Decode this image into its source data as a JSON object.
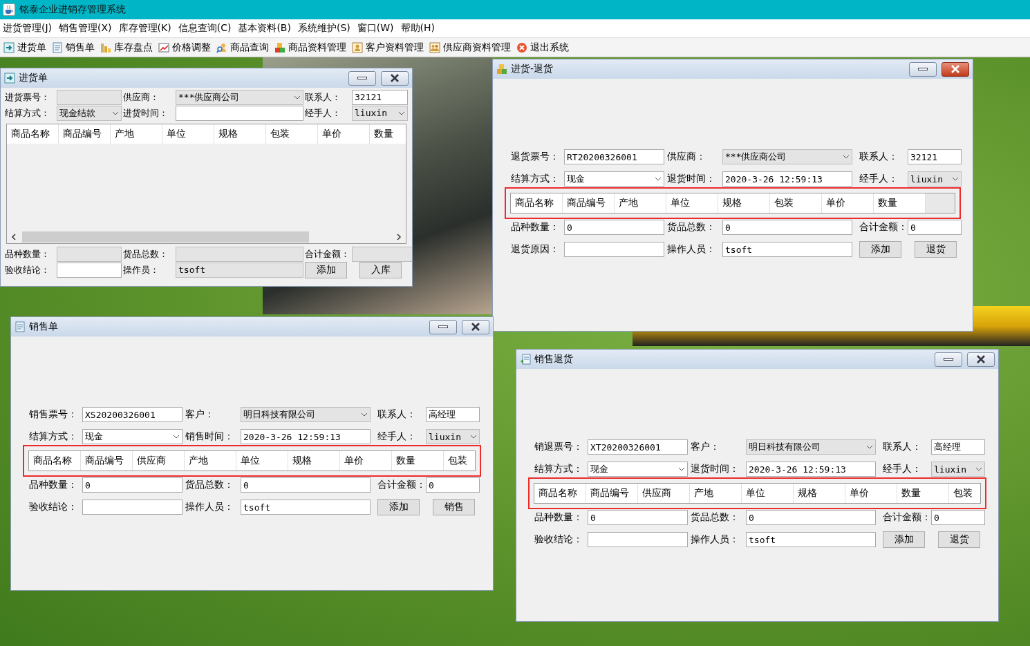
{
  "window": {
    "title": "铭泰企业进销存管理系统"
  },
  "menu": [
    "进货管理(J)",
    "销售管理(X)",
    "库存管理(K)",
    "信息查询(C)",
    "基本资料(B)",
    "系统维护(S)",
    "窗口(W)",
    "帮助(H)"
  ],
  "toolbar": [
    "进货单",
    "销售单",
    "库存盘点",
    "价格调整",
    "商品查询",
    "商品资料管理",
    "客户资料管理",
    "供应商资料管理",
    "退出系统"
  ],
  "windows": [
    {
      "kind": "compact",
      "title": "进货单",
      "active": false,
      "highlighted": false,
      "top_rows": [
        [
          {
            "label": "进货票号：",
            "kind": "text",
            "disabled": true
          },
          {
            "label": "供应商：",
            "value": "***供应商公司",
            "kind": "combo",
            "disabled": true
          },
          {
            "label": "联系人：",
            "value": "32121",
            "kind": "text",
            "disabled": false
          }
        ],
        [
          {
            "label": "结算方式：",
            "value": "现金结款",
            "kind": "combo",
            "disabled": true
          },
          {
            "label": "进货时间：",
            "kind": "text",
            "disabled": false
          },
          {
            "label": "经手人：",
            "value": "liuxin",
            "kind": "combo",
            "disabled": true
          }
        ]
      ],
      "columns": [
        "商品名称",
        "商品编号",
        "产地",
        "单位",
        "规格",
        "包装",
        "单价",
        "数量"
      ],
      "bottom_rows": [
        [
          {
            "label": "品种数量：",
            "kind": "text",
            "disabled": true
          },
          {
            "label": "货品总数：",
            "kind": "text",
            "disabled": true
          },
          {
            "label": "合计金额：",
            "kind": "text",
            "disabled": true
          }
        ],
        [
          {
            "label": "验收结论：",
            "kind": "text",
            "disabled": false
          },
          {
            "label": "操作员：",
            "value": "tsoft",
            "kind": "text",
            "disabled": true
          }
        ]
      ],
      "buttons": [
        "添加",
        "入库"
      ]
    },
    {
      "kind": "spaced",
      "title": "进货-退货",
      "active": true,
      "highlighted": true,
      "top_rows": [
        [
          {
            "label": "退货票号：",
            "value": "RT20200326001",
            "kind": "text",
            "disabled": false
          },
          {
            "label": "供应商：",
            "value": "***供应商公司",
            "kind": "combo",
            "disabled": true
          },
          {
            "label": "联系人：",
            "value": "32121",
            "kind": "text",
            "disabled": false
          }
        ],
        [
          {
            "label": "结算方式：",
            "value": "现金",
            "kind": "combo",
            "disabled": false
          },
          {
            "label": "退货时间：",
            "value": "2020-3-26 12:59:13",
            "kind": "text",
            "disabled": false
          },
          {
            "label": "经手人：",
            "value": "liuxin",
            "kind": "combo",
            "disabled": true
          }
        ]
      ],
      "columns": [
        "商品名称",
        "商品编号",
        "产地",
        "单位",
        "规格",
        "包装",
        "单价",
        "数量"
      ],
      "bottom_rows": [
        [
          {
            "label": "品种数量：",
            "value": "0",
            "kind": "text",
            "disabled": false
          },
          {
            "label": "货品总数：",
            "value": "0",
            "kind": "text",
            "disabled": false
          },
          {
            "label": "合计金额：",
            "value": "0",
            "kind": "text",
            "disabled": false
          }
        ],
        [
          {
            "label": "退货原因：",
            "kind": "text",
            "disabled": false
          },
          {
            "label": "操作人员：",
            "value": "tsoft",
            "kind": "text",
            "disabled": false
          }
        ]
      ],
      "buttons": [
        "添加",
        "退货"
      ]
    },
    {
      "kind": "spaced",
      "title": "销售单",
      "active": false,
      "highlighted": true,
      "top_rows": [
        [
          {
            "label": "销售票号：",
            "value": "XS20200326001",
            "kind": "text",
            "disabled": false
          },
          {
            "label": "客户：",
            "value": "明日科技有限公司",
            "kind": "combo",
            "disabled": true
          },
          {
            "label": "联系人：",
            "value": "高经理",
            "kind": "text",
            "disabled": false
          }
        ],
        [
          {
            "label": "结算方式：",
            "value": "现金",
            "kind": "combo",
            "disabled": false
          },
          {
            "label": "销售时间：",
            "value": "2020-3-26 12:59:13",
            "kind": "text",
            "disabled": false
          },
          {
            "label": "经手人：",
            "value": "liuxin",
            "kind": "combo",
            "disabled": true
          }
        ]
      ],
      "columns": [
        "商品名称",
        "商品编号",
        "供应商",
        "产地",
        "单位",
        "规格",
        "单价",
        "数量",
        "包装"
      ],
      "bottom_rows": [
        [
          {
            "label": "品种数量：",
            "value": "0",
            "kind": "text",
            "disabled": false
          },
          {
            "label": "货品总数：",
            "value": "0",
            "kind": "text",
            "disabled": false
          },
          {
            "label": "合计金额：",
            "value": "0",
            "kind": "text",
            "disabled": false
          }
        ],
        [
          {
            "label": "验收结论：",
            "kind": "text",
            "disabled": false
          },
          {
            "label": "操作人员：",
            "value": "tsoft",
            "kind": "text",
            "disabled": false
          }
        ]
      ],
      "buttons": [
        "添加",
        "销售"
      ]
    },
    {
      "kind": "spaced",
      "title": "销售退货",
      "active": false,
      "highlighted": true,
      "top_rows": [
        [
          {
            "label": "销退票号：",
            "value": "XT20200326001",
            "kind": "text",
            "disabled": false
          },
          {
            "label": "客户：",
            "value": "明日科技有限公司",
            "kind": "combo",
            "disabled": true
          },
          {
            "label": "联系人：",
            "value": "高经理",
            "kind": "text",
            "disabled": false
          }
        ],
        [
          {
            "label": "结算方式：",
            "value": "现金",
            "kind": "combo",
            "disabled": false
          },
          {
            "label": "退货时间：",
            "value": "2020-3-26 12:59:13",
            "kind": "text",
            "disabled": false
          },
          {
            "label": "经手人：",
            "value": "liuxin",
            "kind": "combo",
            "disabled": true
          }
        ]
      ],
      "columns": [
        "商品名称",
        "商品编号",
        "供应商",
        "产地",
        "单位",
        "规格",
        "单价",
        "数量",
        "包装"
      ],
      "bottom_rows": [
        [
          {
            "label": "品种数量：",
            "value": "0",
            "kind": "text",
            "disabled": false
          },
          {
            "label": "货品总数：",
            "value": "0",
            "kind": "text",
            "disabled": false
          },
          {
            "label": "合计金额：",
            "value": "0",
            "kind": "text",
            "disabled": false
          }
        ],
        [
          {
            "label": "验收结论：",
            "kind": "text",
            "disabled": false
          },
          {
            "label": "操作人员：",
            "value": "tsoft",
            "kind": "text",
            "disabled": false
          }
        ]
      ],
      "buttons": [
        "添加",
        "退货"
      ]
    }
  ]
}
